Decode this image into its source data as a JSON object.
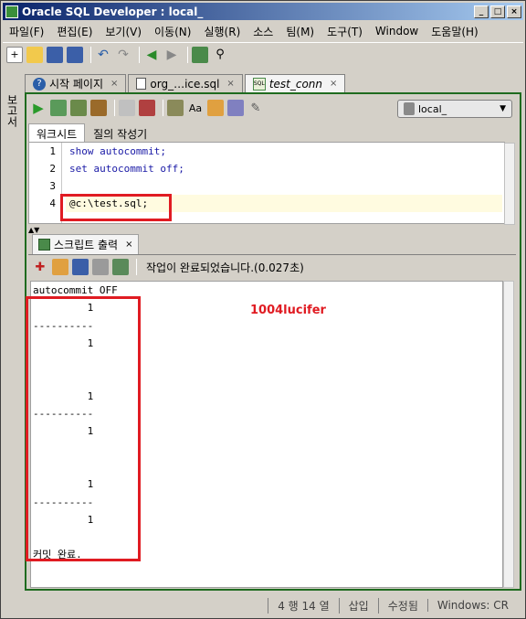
{
  "window": {
    "title": "Oracle SQL Developer : local_"
  },
  "colors": {
    "highlight_box": "#e01b22",
    "keyword": "#1a1aa6",
    "panel_border": "#1f6b1f"
  },
  "menu": [
    "파일(F)",
    "편집(E)",
    "보기(V)",
    "이동(N)",
    "실행(R)",
    "소스",
    "팀(M)",
    "도구(T)",
    "Window",
    "도움말(H)"
  ],
  "left_rail": {
    "label": "보고서"
  },
  "doc_tabs": [
    {
      "label": "시작 페이지",
      "icon": "help-icon"
    },
    {
      "label": "org_…ice.sql",
      "icon": "sql-file-icon"
    },
    {
      "label": "test_conn",
      "icon": "sql-worksheet-icon"
    }
  ],
  "connection": {
    "label": "local_"
  },
  "worksheet": {
    "tab_active": "워크시트",
    "tab_inactive": "질의 작성기"
  },
  "editor": {
    "line_numbers": [
      "1",
      "2",
      "3",
      "4"
    ],
    "lines": [
      "show autocommit;",
      "set autocommit off;",
      "",
      "@c:\\test.sql;"
    ]
  },
  "output": {
    "tab_label": "스크립트 출력",
    "status": "작업이 완료되었습니다.(0.027초)",
    "watermark": "1004lucifer",
    "lines": [
      "autocommit OFF",
      "         1",
      "----------",
      "         1",
      "",
      "",
      "         1",
      "----------",
      "         1",
      "",
      "",
      "         1",
      "----------",
      "         1",
      "",
      "커밋 완료."
    ]
  },
  "statusbar": {
    "position": "4 행 14 열",
    "mode": "삽입",
    "modified": "수정됨",
    "eol": "Windows: CR"
  }
}
